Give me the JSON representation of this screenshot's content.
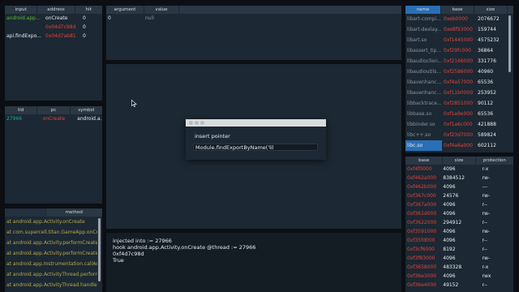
{
  "hooks_table": {
    "columns": [
      "input",
      "address",
      "hit"
    ],
    "rows": [
      {
        "input": "android.app...",
        "address": "onCreate",
        "hit": "0"
      },
      {
        "input": "",
        "address": "0x04d7c98d",
        "hit": "0"
      },
      {
        "input": "api.findExpo...",
        "address": "0x04d7ab81",
        "hit": "0"
      }
    ]
  },
  "args_table": {
    "columns": [
      "argument",
      "value"
    ],
    "rows": [
      {
        "argument": "0",
        "value": "null"
      }
    ]
  },
  "modules_table": {
    "columns": [
      "name",
      "base",
      "size"
    ],
    "rows": [
      {
        "name": "libart-compi...",
        "base": "0xeb0000",
        "size": "2076672"
      },
      {
        "name": "libart-dexlay...",
        "base": "0xe8f93000",
        "size": "159744"
      },
      {
        "name": "libart.so",
        "base": "0xf1445000",
        "size": "4575232"
      },
      {
        "name": "libassert_tip...",
        "base": "0xf29fc000",
        "size": "36864"
      },
      {
        "name": "libaudioclien...",
        "base": "0xf2166000",
        "size": "331776"
      },
      {
        "name": "libaudioutils...",
        "base": "0xf2586000",
        "size": "40960"
      },
      {
        "name": "libavenhanc...",
        "base": "0xf4a57000",
        "size": "65536"
      },
      {
        "name": "libavenhanc...",
        "base": "0xf11b0000",
        "size": "253952"
      },
      {
        "name": "libbacktrace...",
        "base": "0xf2851000",
        "size": "90112"
      },
      {
        "name": "libbase.so",
        "base": "0xf1a9e000",
        "size": "65536"
      },
      {
        "name": "libbinder.so",
        "base": "0xf1a6c000",
        "size": "421888"
      },
      {
        "name": "libc++.so",
        "base": "0xf23d7000",
        "size": "589824"
      },
      {
        "name": "libc.so",
        "base": "0xf4a6a000",
        "size": "602112"
      }
    ],
    "selected_index": 12
  },
  "ranges_table": {
    "columns": [
      "base",
      "size",
      "protection"
    ],
    "rows": [
      {
        "base": "0xf4f0000",
        "size": "4096",
        "protection": "r-x"
      },
      {
        "base": "0xf462a000",
        "size": "8384512",
        "protection": "rw-"
      },
      {
        "base": "0xf462b000",
        "size": "4096",
        "protection": "---"
      },
      {
        "base": "0xf367c000",
        "size": "24576",
        "protection": "rw-"
      },
      {
        "base": "0xf367a000",
        "size": "4096",
        "protection": "r--"
      },
      {
        "base": "0xf361d000",
        "size": "4096",
        "protection": "rw-"
      },
      {
        "base": "0xf3622000",
        "size": "294912",
        "protection": "r--"
      },
      {
        "base": "0xf3591000",
        "size": "4096",
        "protection": "rw-"
      },
      {
        "base": "0xf35fd000",
        "size": "4096",
        "protection": "r--"
      },
      {
        "base": "0xf3cf6000",
        "size": "8192",
        "protection": "r--"
      },
      {
        "base": "0xf3f83000",
        "size": "4096",
        "protection": "rw-"
      },
      {
        "base": "0xf3658000",
        "size": "483328",
        "protection": "r-x"
      },
      {
        "base": "0xf36e3000",
        "size": "4096",
        "protection": "rwx"
      },
      {
        "base": "0xf36e4000",
        "size": "49152",
        "protection": "r--"
      }
    ]
  },
  "threads_table": {
    "columns": [
      "tid",
      "pc",
      "symbol"
    ],
    "rows": [
      {
        "tid": "27966",
        "pc": "onCreate",
        "symbol": "android.a..."
      }
    ]
  },
  "backtrace_table": {
    "columns": [
      "method"
    ],
    "rows": [
      "at android.app.Activity.onCreate",
      "at com.supercell.titan.GameApp.onCreate",
      "at android.app.Activity.performCreate",
      "at android.app.Activity.performCreate",
      "at android.app.Instrumentation.callActivity",
      "at android.app.ActivityThread.performLaunch",
      "at android.app.ActivityThread.handleLaunch"
    ]
  },
  "console": {
    "lines": [
      "injected into := 27966",
      "hook android.app.Activity.onCreate  @thread := 27966",
      "0xf4d7c98d",
      "True"
    ]
  },
  "dialog": {
    "title": "insert pointer",
    "input_value": "Module.findExportByName('lil"
  },
  "colors": {
    "background": "#0b0f14",
    "panel": "#1c2833",
    "header": "#2a3744",
    "selection": "#2a6fb5",
    "address_red": "#e0443e",
    "hook_green": "#5bbf2d",
    "tid_teal": "#1fa89a",
    "backtrace_olive": "#b8a94a"
  }
}
